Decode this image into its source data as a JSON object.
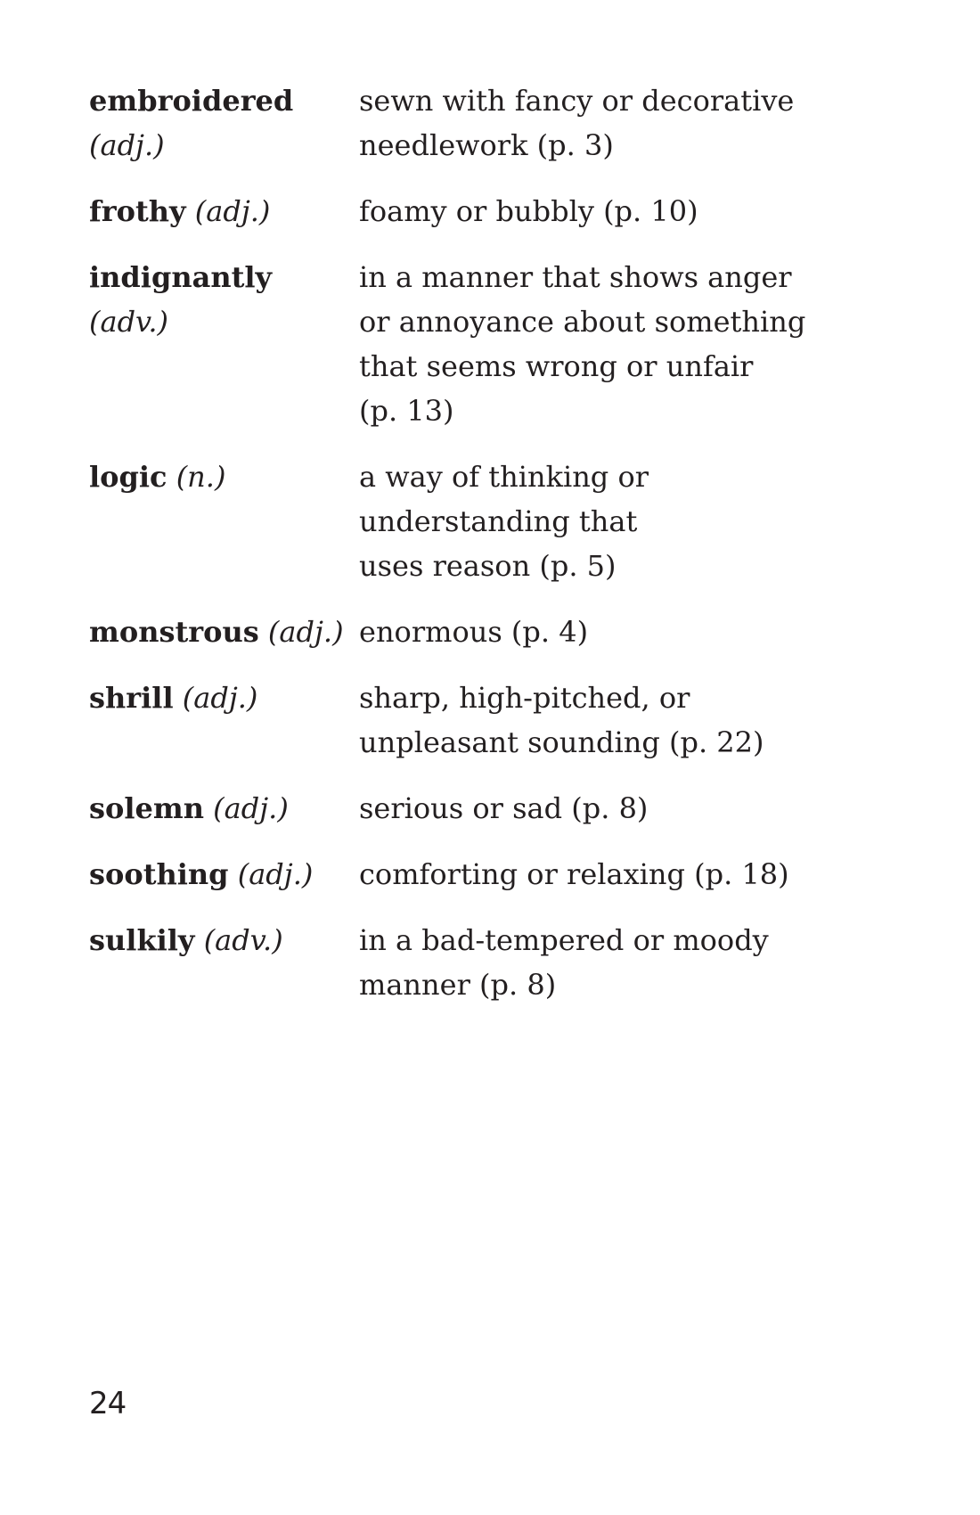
{
  "glossary": {
    "entries": [
      {
        "word": "embroidered",
        "pos": "(adj.)",
        "definition_lines": [
          "sewn with fancy or decorative",
          "needlework (p. 3)"
        ]
      },
      {
        "word": "frothy",
        "pos": "(adj.)",
        "definition_lines": [
          "foamy or bubbly (p. 10)"
        ]
      },
      {
        "word": "indignantly",
        "pos": "(adv.)",
        "definition_lines": [
          "in a manner that shows anger",
          "or annoyance about something",
          "that seems wrong or unfair",
          "(p. 13)"
        ]
      },
      {
        "word": "logic",
        "pos": "(n.)",
        "definition_lines": [
          "a way of thinking or",
          "understanding that",
          "uses reason (p. 5)"
        ]
      },
      {
        "word": "monstrous",
        "pos": "(adj.)",
        "definition_lines": [
          "enormous (p. 4)"
        ]
      },
      {
        "word": "shrill",
        "pos": "(adj.)",
        "definition_lines": [
          "sharp, high-pitched, or",
          "unpleasant sounding (p. 22)"
        ]
      },
      {
        "word": "solemn",
        "pos": "(adj.)",
        "definition_lines": [
          "serious or sad (p. 8)"
        ]
      },
      {
        "word": "soothing",
        "pos": "(adj.)",
        "definition_lines": [
          "comforting or relaxing (p. 18)"
        ]
      },
      {
        "word": "sulkily",
        "pos": "(adv.)",
        "definition_lines": [
          "in a bad-tempered or moody",
          "manner (p. 8)"
        ]
      }
    ]
  },
  "page_number": "24"
}
